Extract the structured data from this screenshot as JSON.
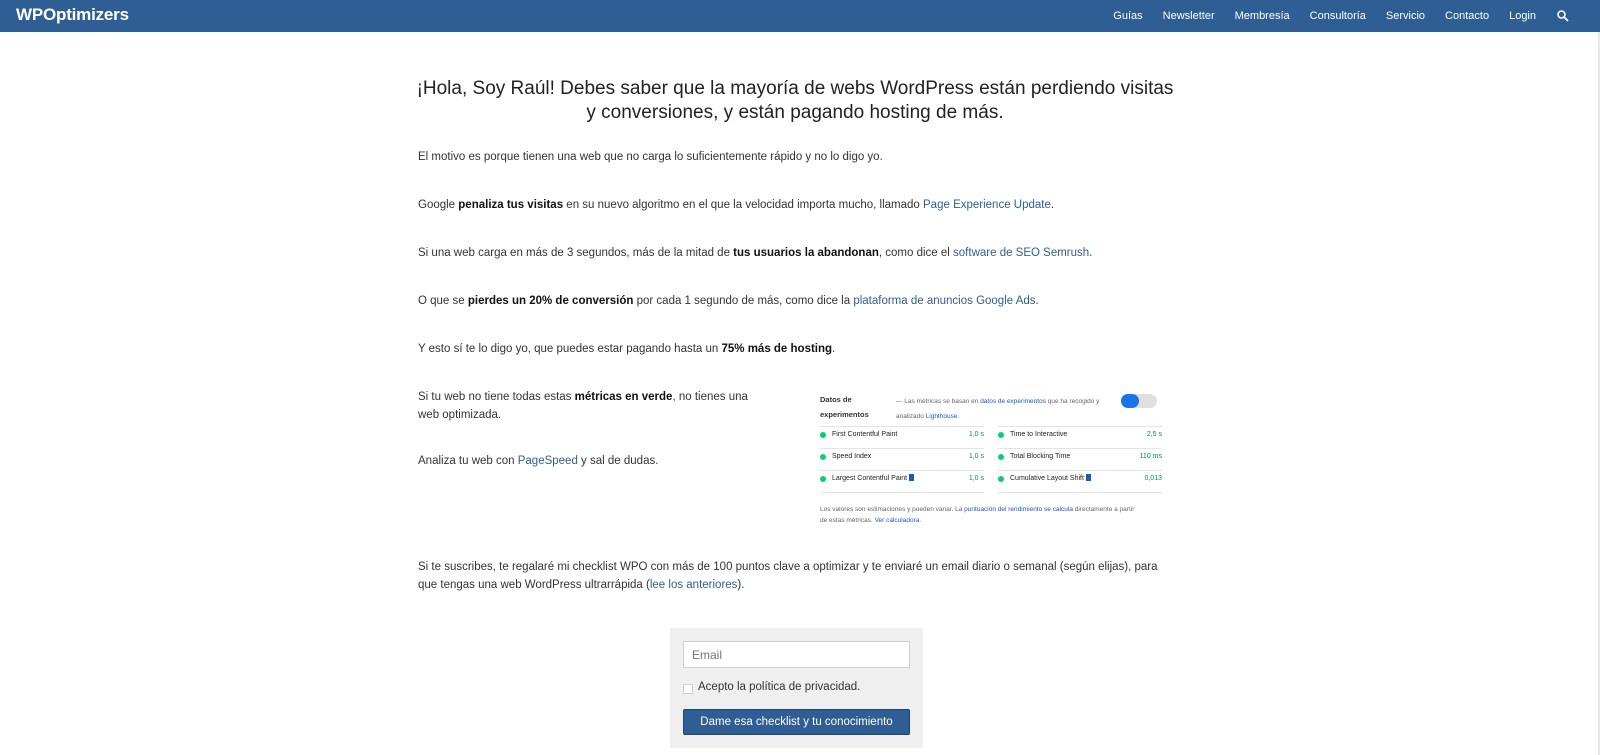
{
  "header": {
    "brand": "WPOptimizers",
    "nav": [
      "Guías",
      "Newsletter",
      "Membresía",
      "Consultoría",
      "Servicio",
      "Contacto",
      "Login"
    ],
    "search_icon": "search-icon",
    "bg_color": "#2e5e93"
  },
  "main": {
    "headline": "¡Hola, Soy Raúl! Debes saber que la mayoría de webs WordPress están perdiendo visitas y conversiones, y están pagando hosting de más.",
    "p1": "El motivo es porque tienen una web que no carga lo suficientemente rápido y no lo digo yo.",
    "p2": {
      "a": "Google ",
      "b": "penaliza tus visitas",
      "c": " en su nuevo algoritmo en el que la velocidad importa mucho, llamado ",
      "link": "Page Experience Update",
      "d": "."
    },
    "p3": {
      "a": "Si una web carga en más de 3 segundos, más de la mitad de ",
      "b": "tus usuarios la abandonan",
      "c": ", como dice el ",
      "link": "software de SEO Semrush",
      "d": "."
    },
    "p4": {
      "a": "O que se ",
      "b": "pierdes un 20% de conversión",
      "c": " por cada 1 segundo de más, como dice la ",
      "link": "plataforma de anuncios Google Ads",
      "d": "."
    },
    "p5": {
      "a": "Y esto sí te lo digo yo, que puedes estar pagando hasta un ",
      "b": "75% más de hosting",
      "c": "."
    },
    "p6": {
      "a": "Si tu web no tiene todas estas ",
      "b": "métricas en verde",
      "c": ", no tienes una web optimizada."
    },
    "p7": {
      "a": "Analiza tu web con ",
      "link": "PageSpeed",
      "b": " y sal de dudas."
    },
    "p8": {
      "a": "Si te suscribes, te regalaré mi checklist WPO con más de 100 puntos clave a optimizar y te enviaré un email diario o semanal (según elijas), para que tengas una web WordPress ultrarrápida (",
      "link": "lee los anteriores",
      "b": ")."
    }
  },
  "metrics_card": {
    "title": "Datos de experimentos",
    "note_a": "— Las métricas se basan en ",
    "note_link": "datos de experimentos",
    "note_b": " que ha recogido y analizado ",
    "note_link2": "Lighthouse",
    "note_c": ".",
    "rows": [
      {
        "label": "First Contentful Paint",
        "value": "1,0 s"
      },
      {
        "label": "Time to Interactive",
        "value": "2,5 s"
      },
      {
        "label": "Speed Index",
        "value": "1,0 s"
      },
      {
        "label": "Total Blocking Time",
        "value": "110 ms"
      },
      {
        "label": "Largest Contentful Paint",
        "value": "1,0 s"
      },
      {
        "label": "Cumulative Layout Shift",
        "value": "0,013"
      }
    ],
    "foot_a": "Los valores son estimaciones y pueden variar. La ",
    "foot_link": "puntuación del rendimiento se calcula",
    "foot_b": " directamente a partir de estas métricas. ",
    "foot_link2": "Ver calculadora",
    "foot_c": ".",
    "good_color": "#0cce6b"
  },
  "form": {
    "email_placeholder": "Email",
    "privacy_label": "Acepto la política de privacidad.",
    "submit_label": "Dame esa checklist y tu conocimiento"
  }
}
